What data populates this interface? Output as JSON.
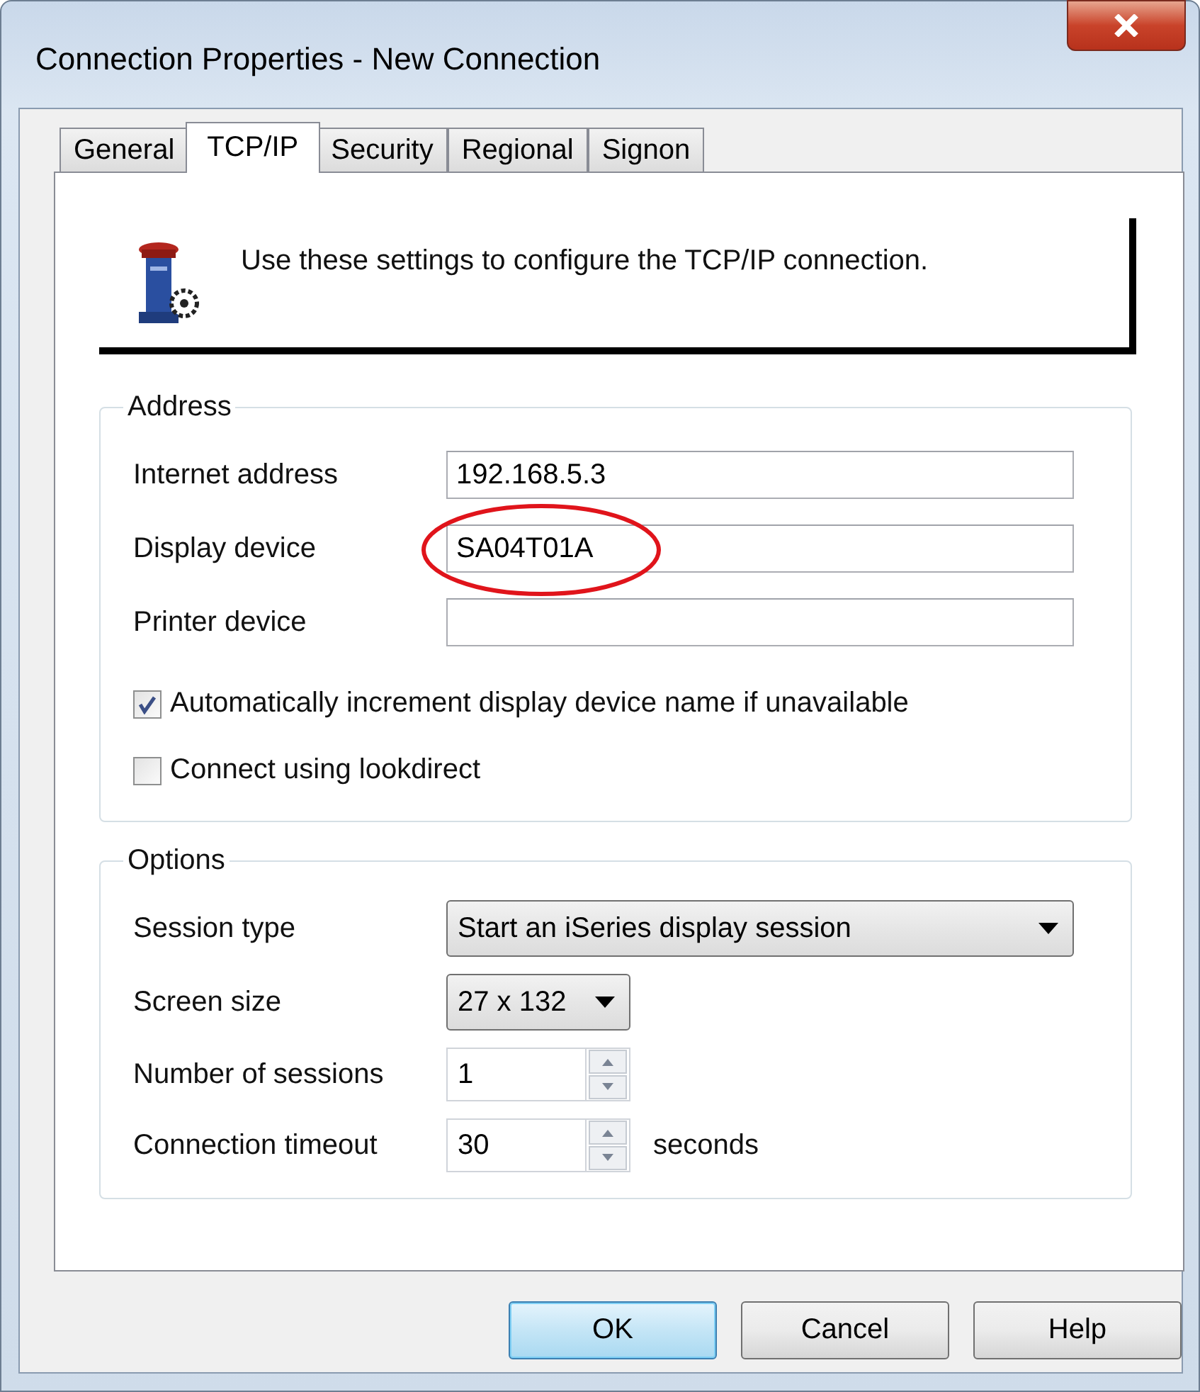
{
  "window": {
    "title": "Connection Properties - New Connection"
  },
  "tabs": [
    {
      "label": "General",
      "selected": false
    },
    {
      "label": "TCP/IP",
      "selected": true
    },
    {
      "label": "Security",
      "selected": false
    },
    {
      "label": "Regional",
      "selected": false
    },
    {
      "label": "Signon",
      "selected": false
    }
  ],
  "banner": {
    "text": "Use these settings to configure the TCP/IP connection."
  },
  "address": {
    "title": "Address",
    "fields": [
      {
        "label": "Internet address",
        "value": "192.168.5.3",
        "circled": false
      },
      {
        "label": "Display device",
        "value": "SA04T01A",
        "circled": true
      },
      {
        "label": "Printer device",
        "circled": false
      }
    ],
    "checkboxes": [
      {
        "label": "Automatically increment display device name if unavailable",
        "checked": true
      },
      {
        "label": "Connect using lookdirect",
        "checked": false
      }
    ]
  },
  "options": {
    "title": "Options",
    "rows": [
      {
        "kind": "combobox",
        "label": "Session type",
        "value": "Start an iSeries display session"
      },
      {
        "kind": "dropdown",
        "label": "Screen size",
        "value": "27 x 132"
      },
      {
        "kind": "spinner",
        "label": "Number of sessions",
        "value": "1"
      },
      {
        "kind": "spinner",
        "label": "Connection timeout",
        "value": "30",
        "unit": "seconds"
      }
    ]
  },
  "buttons": [
    {
      "label": "OK",
      "default": true
    },
    {
      "label": "Cancel",
      "default": false
    },
    {
      "label": "Help",
      "default": false
    }
  ]
}
